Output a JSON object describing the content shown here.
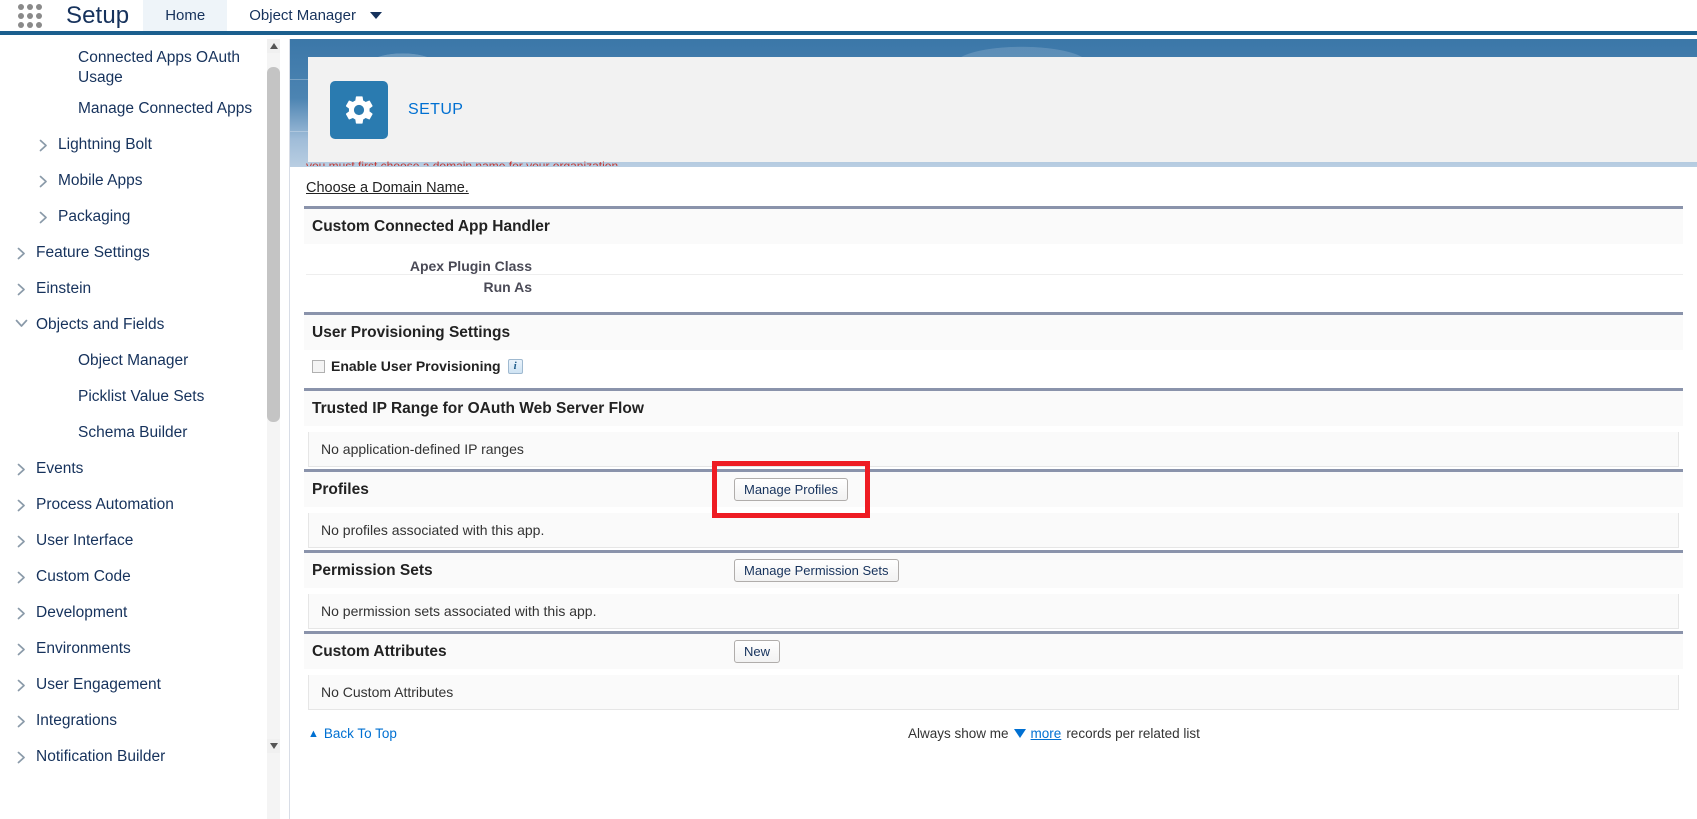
{
  "header": {
    "app_launcher_icon": "app-launcher-grid-icon",
    "product": "Setup",
    "tabs": [
      {
        "label": "Home",
        "active": true,
        "has_caret": false
      },
      {
        "label": "Object Manager",
        "active": false,
        "has_caret": true
      }
    ]
  },
  "sidebar": {
    "items": [
      {
        "label": "Connected Apps OAuth Usage",
        "level": 2,
        "state": "leaf"
      },
      {
        "label": "Manage Connected Apps",
        "level": 2,
        "state": "leaf"
      },
      {
        "label": "Lightning Bolt",
        "level": 1,
        "state": "collapsed"
      },
      {
        "label": "Mobile Apps",
        "level": 1,
        "state": "collapsed"
      },
      {
        "label": "Packaging",
        "level": 1,
        "state": "collapsed"
      },
      {
        "label": "Feature Settings",
        "level": 0,
        "state": "collapsed"
      },
      {
        "label": "Einstein",
        "level": 0,
        "state": "collapsed"
      },
      {
        "label": "Objects and Fields",
        "level": 0,
        "state": "expanded"
      },
      {
        "label": "Object Manager",
        "level": 2,
        "state": "leaf"
      },
      {
        "label": "Picklist Value Sets",
        "level": 2,
        "state": "leaf"
      },
      {
        "label": "Schema Builder",
        "level": 2,
        "state": "leaf"
      },
      {
        "label": "Events",
        "level": 0,
        "state": "collapsed"
      },
      {
        "label": "Process Automation",
        "level": 0,
        "state": "collapsed"
      },
      {
        "label": "User Interface",
        "level": 0,
        "state": "collapsed"
      },
      {
        "label": "Custom Code",
        "level": 0,
        "state": "collapsed"
      },
      {
        "label": "Development",
        "level": 0,
        "state": "collapsed"
      },
      {
        "label": "Environments",
        "level": 0,
        "state": "collapsed"
      },
      {
        "label": "User Engagement",
        "level": 0,
        "state": "collapsed"
      },
      {
        "label": "Integrations",
        "level": 0,
        "state": "collapsed"
      },
      {
        "label": "Notification Builder",
        "level": 0,
        "state": "collapsed"
      }
    ]
  },
  "setup_banner": {
    "icon": "gear-icon",
    "title": "SETUP",
    "accent_color": "#2a7bb0"
  },
  "content": {
    "clipped_error_text": "you must first choose a domain name for your organization.",
    "domain_link": "Choose a Domain Name.",
    "sections": [
      {
        "id": "custom-connected-app-handler",
        "title": "Custom Connected App Handler",
        "button": null,
        "body_style": "fields",
        "fields": [
          {
            "label": "Apex Plugin Class",
            "value": ""
          },
          {
            "label": "Run As",
            "value": ""
          }
        ]
      },
      {
        "id": "user-provisioning-settings",
        "title": "User Provisioning Settings",
        "button": null,
        "body_style": "checkbox",
        "checkbox": {
          "label": "Enable User Provisioning",
          "checked": false,
          "info_icon": "info-icon",
          "info_glyph": "i"
        }
      },
      {
        "id": "trusted-ip-range",
        "title": "Trusted IP Range for OAuth Web Server Flow",
        "button": null,
        "body_style": "message",
        "message": "No application-defined IP ranges"
      },
      {
        "id": "profiles",
        "title": "Profiles",
        "button": "Manage Profiles",
        "button_highlighted": true,
        "body_style": "message",
        "message": "No profiles associated with this app."
      },
      {
        "id": "permission-sets",
        "title": "Permission Sets",
        "button": "Manage Permission Sets",
        "button_highlighted": false,
        "body_style": "message",
        "message": "No permission sets associated with this app."
      },
      {
        "id": "custom-attributes",
        "title": "Custom Attributes",
        "button": "New",
        "button_highlighted": false,
        "body_style": "message",
        "message": "No Custom Attributes"
      }
    ],
    "footer": {
      "back_to_top": "Back To Top",
      "show_me_prefix": "Always show me",
      "more_link": "more",
      "show_me_suffix": "records per related list"
    }
  },
  "colors": {
    "header_accent": "#1b5f8e",
    "link": "#0070d2",
    "annotation": "#ee1c23",
    "section_rule": "#8a93ab"
  }
}
